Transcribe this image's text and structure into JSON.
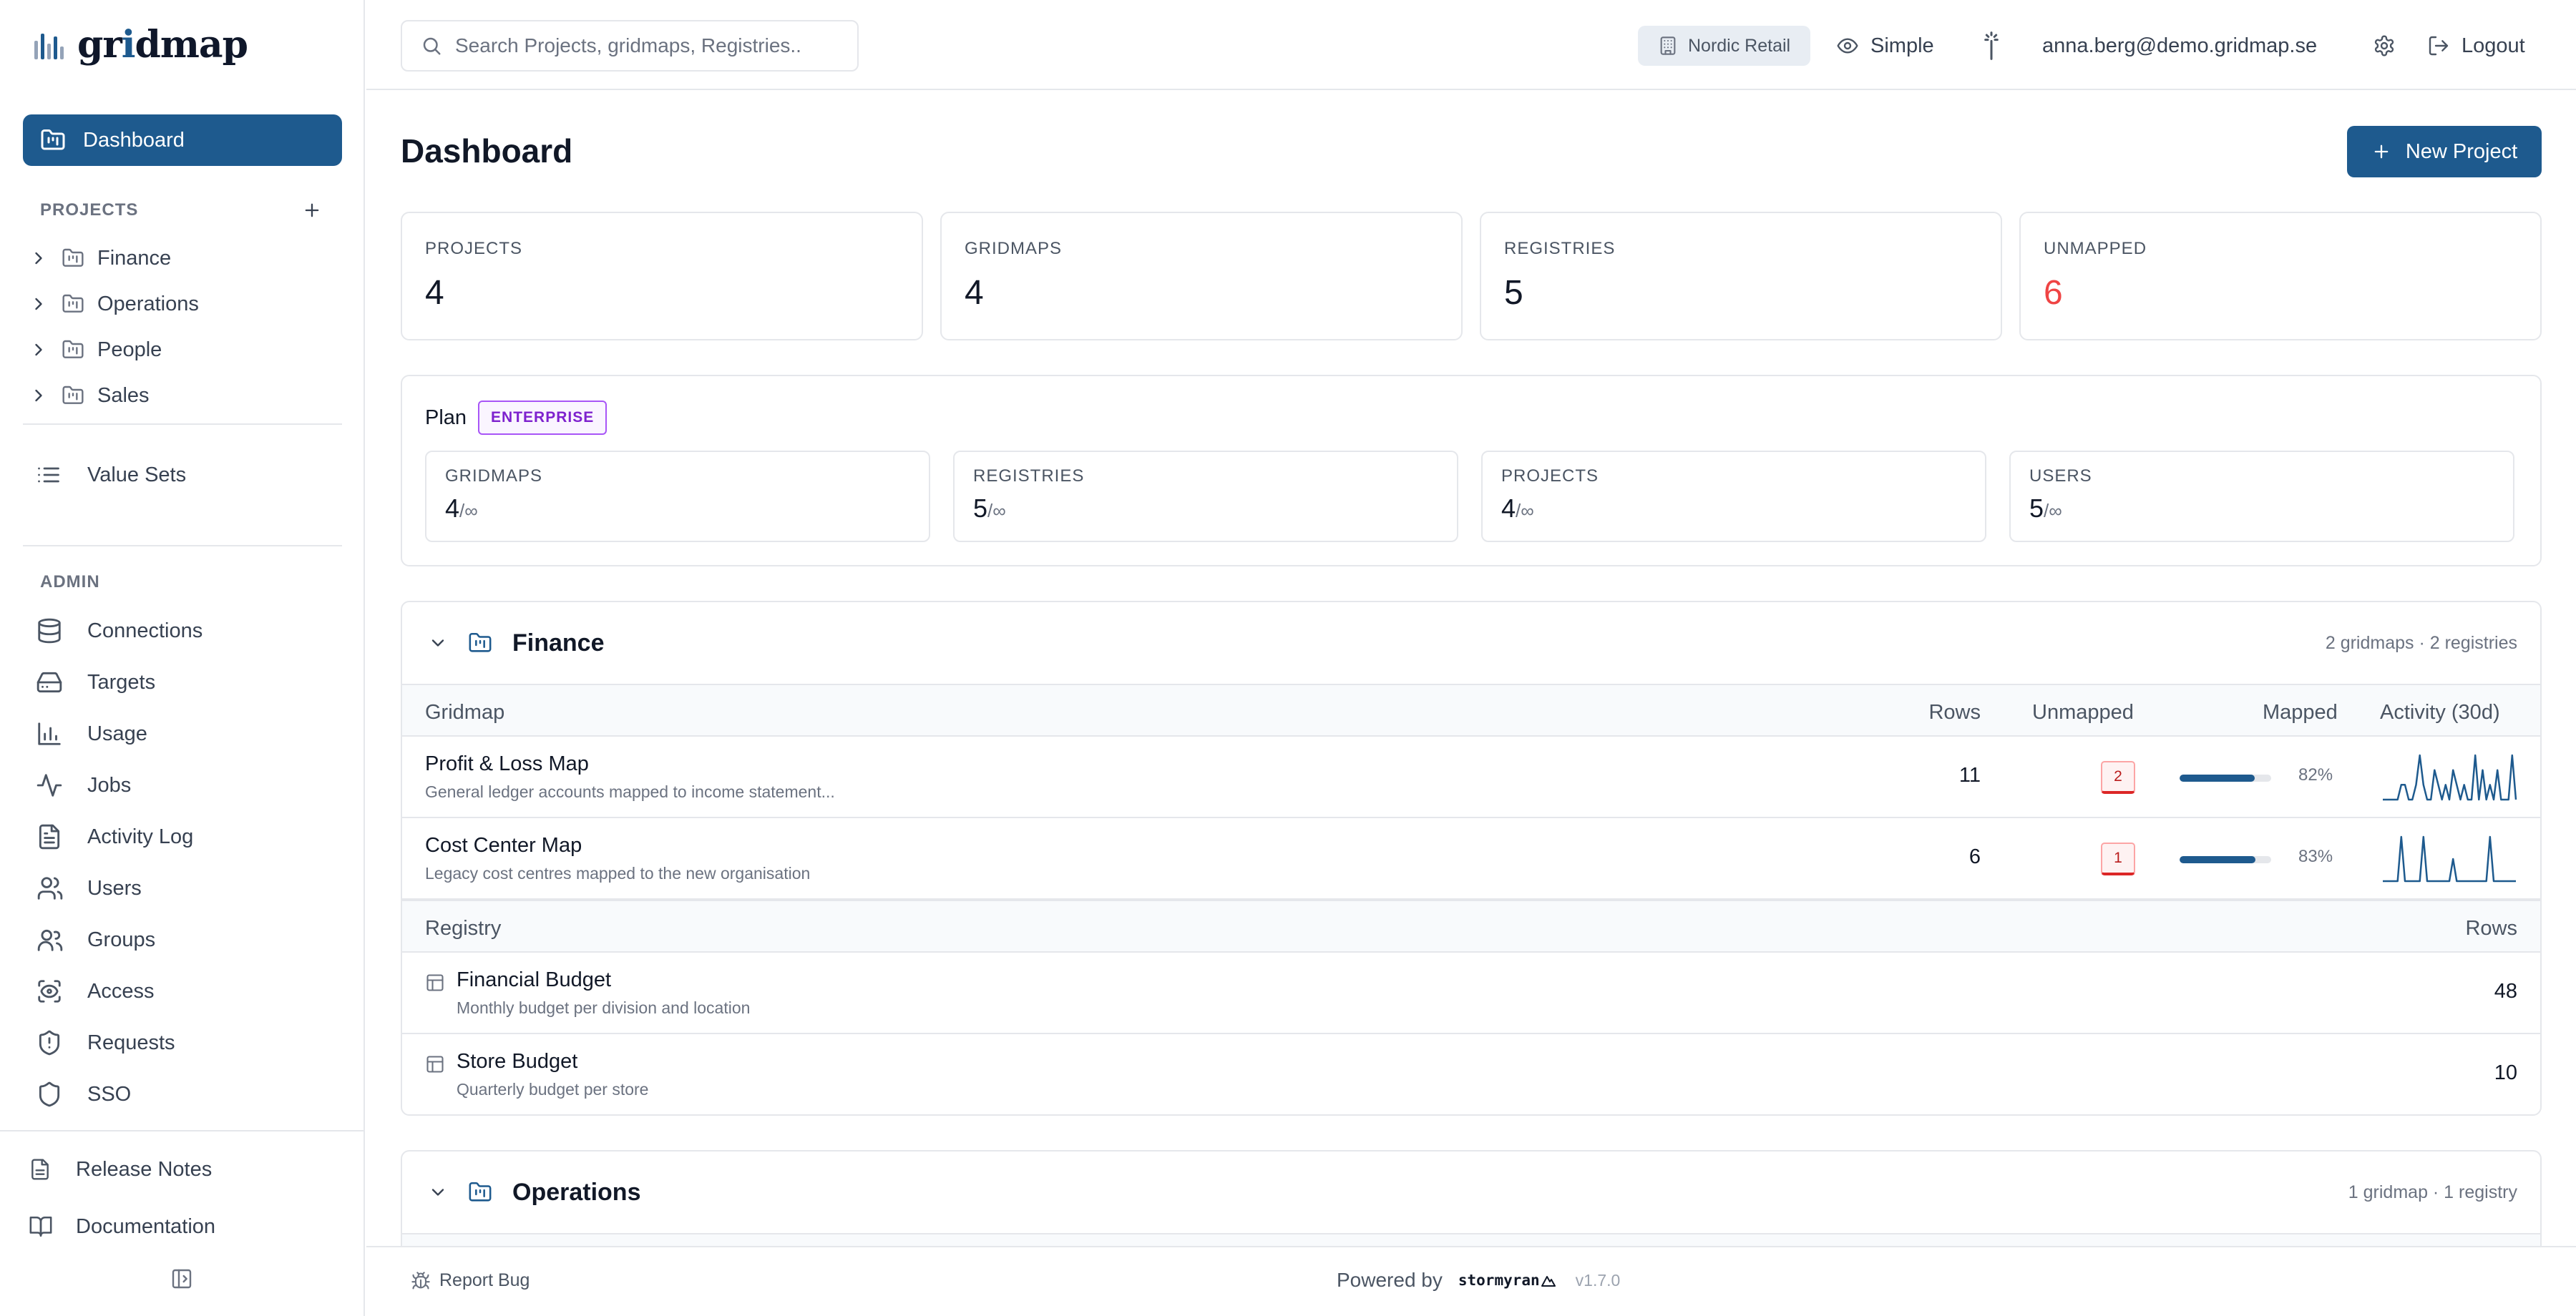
{
  "app": {
    "logo_text_pre": "gr",
    "logo_text_i": "i",
    "logo_text_post": "dmap"
  },
  "sidebar": {
    "dashboard_label": "Dashboard",
    "projects_heading": "PROJECTS",
    "projects": [
      {
        "label": "Finance"
      },
      {
        "label": "Operations"
      },
      {
        "label": "People"
      },
      {
        "label": "Sales"
      }
    ],
    "value_sets_label": "Value Sets",
    "admin_heading": "ADMIN",
    "admin_items": [
      {
        "label": "Connections",
        "icon": "database-icon"
      },
      {
        "label": "Targets",
        "icon": "hard-drive-icon"
      },
      {
        "label": "Usage",
        "icon": "bar-chart-icon"
      },
      {
        "label": "Jobs",
        "icon": "activity-icon"
      },
      {
        "label": "Activity Log",
        "icon": "file-text-icon"
      },
      {
        "label": "Users",
        "icon": "users-icon"
      },
      {
        "label": "Groups",
        "icon": "user-group-icon"
      },
      {
        "label": "Access",
        "icon": "scan-eye-icon"
      },
      {
        "label": "Requests",
        "icon": "shield-alert-icon"
      },
      {
        "label": "SSO",
        "icon": "shield-icon"
      }
    ],
    "release_notes_label": "Release Notes",
    "documentation_label": "Documentation"
  },
  "topbar": {
    "search_placeholder": "Search Projects, gridmaps, Registries..",
    "org_name": "Nordic Retail",
    "view_mode": "Simple",
    "user_email": "anna.berg@demo.gridmap.se",
    "logout_label": "Logout"
  },
  "main": {
    "title": "Dashboard",
    "new_project_label": "New Project",
    "stats": [
      {
        "label": "PROJECTS",
        "value": "4"
      },
      {
        "label": "GRIDMAPS",
        "value": "4"
      },
      {
        "label": "REGISTRIES",
        "value": "5"
      },
      {
        "label": "UNMAPPED",
        "value": "6"
      }
    ],
    "plan": {
      "label": "Plan",
      "tier": "ENTERPRISE",
      "quotas": [
        {
          "label": "GRIDMAPS",
          "used": "4",
          "limit": "/∞"
        },
        {
          "label": "REGISTRIES",
          "used": "5",
          "limit": "/∞"
        },
        {
          "label": "PROJECTS",
          "used": "4",
          "limit": "/∞"
        },
        {
          "label": "USERS",
          "used": "5",
          "limit": "/∞"
        }
      ]
    },
    "finance": {
      "name": "Finance",
      "meta": "2 gridmaps · 2 registries",
      "gridmap_columns": {
        "gridmap": "Gridmap",
        "rows": "Rows",
        "unmapped": "Unmapped",
        "mapped": "Mapped",
        "activity": "Activity (30d)"
      },
      "gridmaps": [
        {
          "name": "Profit & Loss Map",
          "description": "General ledger accounts mapped to income statement...",
          "rows": "11",
          "unmapped": "2",
          "mapped_pct": "82%",
          "mapped_fraction": 0.82,
          "activity": [
            0,
            0,
            0,
            0,
            0,
            1,
            1,
            0,
            0,
            1,
            3,
            1,
            0,
            0,
            2,
            1,
            0,
            1,
            0,
            2,
            1,
            0,
            1,
            0,
            0,
            3,
            0,
            2,
            0,
            1,
            0,
            2,
            0,
            0,
            0,
            3,
            0
          ]
        },
        {
          "name": "Cost Center Map",
          "description": "Legacy cost centres mapped to the new organisation",
          "rows": "6",
          "unmapped": "1",
          "mapped_pct": "83%",
          "mapped_fraction": 0.83,
          "activity": [
            0,
            0,
            0,
            0,
            0,
            3,
            0,
            0,
            0,
            0,
            0,
            3,
            0,
            0,
            0,
            0,
            0,
            0,
            0,
            1.5,
            0,
            0,
            0,
            0,
            0,
            0,
            0,
            0,
            0,
            3,
            0,
            0,
            0,
            0,
            0,
            0,
            0
          ]
        }
      ],
      "registry_columns": {
        "registry": "Registry",
        "rows": "Rows"
      },
      "registries": [
        {
          "name": "Financial Budget",
          "description": "Monthly budget per division and location",
          "rows": "48"
        },
        {
          "name": "Store Budget",
          "description": "Quarterly budget per store",
          "rows": "10"
        }
      ]
    },
    "operations": {
      "name": "Operations",
      "meta": "1 gridmap · 1 registry"
    }
  },
  "footer": {
    "report_bug_label": "Report Bug",
    "powered_by": "Powered by",
    "brand": "stormyran",
    "version": "v1.7.0"
  },
  "colors": {
    "primary": "#1e5a8e",
    "danger": "#ef4444",
    "badge_purple": "#7e22ce"
  }
}
